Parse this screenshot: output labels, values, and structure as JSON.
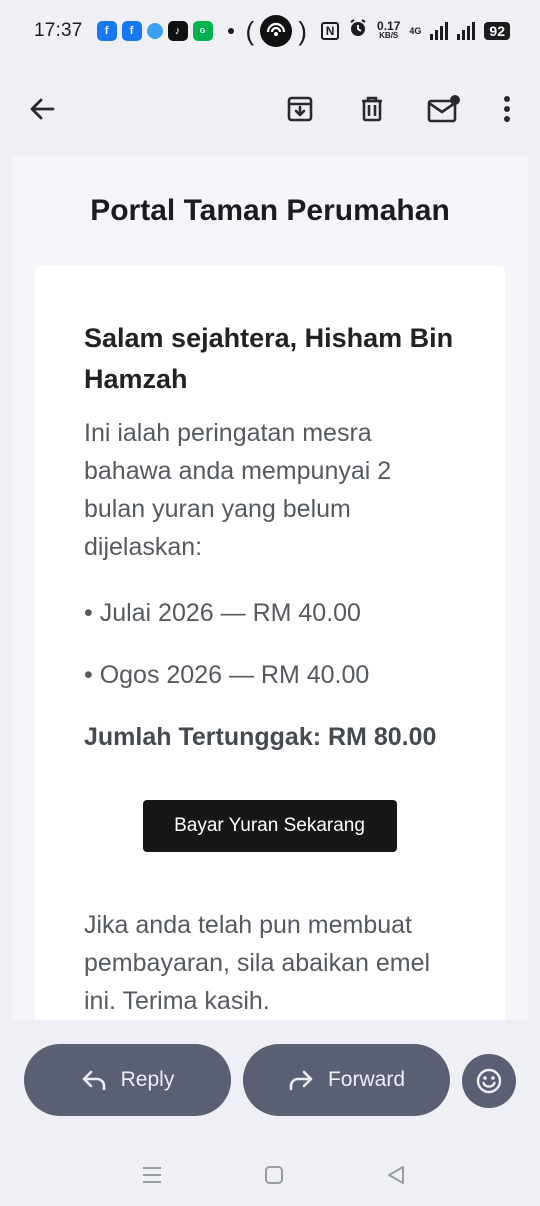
{
  "status_bar": {
    "time": "17:37",
    "speed_value": "0.17",
    "speed_unit": "KB/S",
    "network": "4G",
    "battery": "92"
  },
  "app_bar": {
    "icons": [
      "back-arrow-icon",
      "archive-icon",
      "delete-icon",
      "mark-unread-icon",
      "more-vert-icon"
    ]
  },
  "email": {
    "header_title": "Portal Taman Perumahan",
    "greeting": "Salam sejahtera, Hisham Bin Hamzah",
    "intro": "Ini ialah peringatan mesra bahawa anda mempunyai 2 bulan yuran yang belum dijelaskan:",
    "items": [
      "• Julai 2026 — RM 40.00",
      "• Ogos 2026 — RM 40.00"
    ],
    "total": "Jumlah Tertunggak: RM 80.00",
    "pay_button": "Bayar Yuran Sekarang",
    "closing": "Jika anda telah pun membuat pembayaran, sila abaikan emel ini. Terima kasih."
  },
  "actions": {
    "reply": "Reply",
    "forward": "Forward"
  },
  "colors": {
    "pill": "#5a5f74",
    "button": "#17171a",
    "background": "#eef0f6"
  }
}
